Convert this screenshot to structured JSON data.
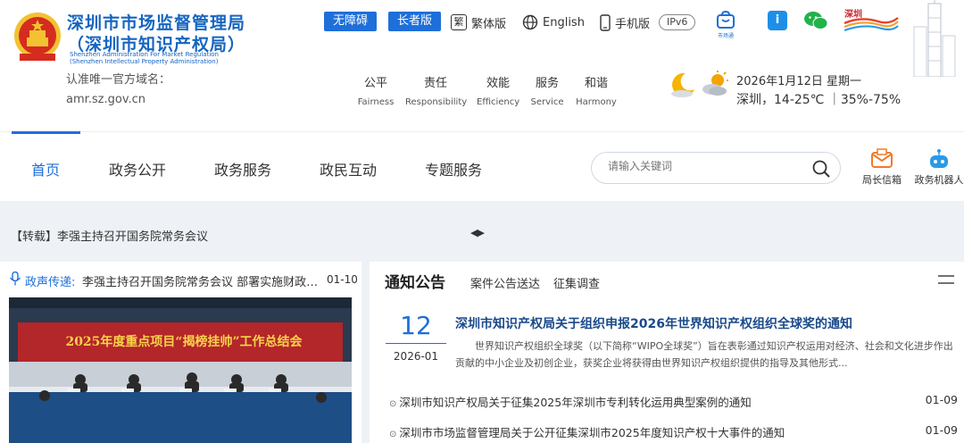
{
  "header": {
    "title_line1": "深圳市市场监督管理局",
    "title_line2": "（深圳市知识产权局）",
    "subtitle_en_line1": "Shenzhen Administration For Market Regulation",
    "subtitle_en_line2": "(Shenzhen Intellectual Property Administration)",
    "domain_notice": "认准唯一官方域名：amr.sz.gov.cn",
    "emblem_label": "national-emblem"
  },
  "toolbar": {
    "accessibility": "无障碍",
    "elderly": "长者版",
    "traditional": "繁体版",
    "english": "English",
    "mobile": "手机版",
    "ipv6": "IPv6",
    "app1_label": "市场通",
    "accent_color": "#1e6fd9"
  },
  "mottos": [
    {
      "zh": "公平",
      "en": "Fairness"
    },
    {
      "zh": "责任",
      "en": "Responsibility"
    },
    {
      "zh": "效能",
      "en": "Efficiency"
    },
    {
      "zh": "服务",
      "en": "Service"
    },
    {
      "zh": "和谐",
      "en": "Harmony"
    }
  ],
  "weather": {
    "date": "2026年1月12日 星期一",
    "info": "深圳，14-25℃ ｜35%-75%"
  },
  "nav": {
    "items": [
      "首页",
      "政务公开",
      "政务服务",
      "政民互动",
      "专题服务"
    ],
    "active": "首页",
    "search_placeholder": "请输入关键词",
    "mailbox": "局长信箱",
    "robot": "政务机器人"
  },
  "headline": {
    "text": "【转载】李强主持召开国务院常务会议",
    "arrows": "◀▶"
  },
  "broadcast": {
    "label": "政声传递:",
    "text": "李强主持召开国务院常务会议 部署实施财政金融...",
    "date": "01-10",
    "photo_banner": "2025年度重点项目“揭榜挂帅”工作总结会"
  },
  "notices": {
    "tabs": [
      "通知公告",
      "案件公告送达",
      "征集调查"
    ],
    "feature": {
      "day": "12",
      "year_month": "2026-01",
      "title": "深圳市知识产权局关于组织申报2026年世界知识产权组织全球奖的通知",
      "summary": "世界知识产权组织全球奖（以下简称“WIPO全球奖”）旨在表彰通过知识产权运用对经济、社会和文化进步作出贡献的中小企业及初创企业，获奖企业将获得由世界知识产权组织提供的指导及其他形式..."
    },
    "list": [
      {
        "title": "深圳市知识产权局关于征集2025年深圳市专利转化运用典型案例的通知",
        "date": "01-09"
      },
      {
        "title": "深圳市市场监督管理局关于公开征集深圳市2025年度知识产权十大事件的通知",
        "date": "01-09"
      }
    ]
  }
}
